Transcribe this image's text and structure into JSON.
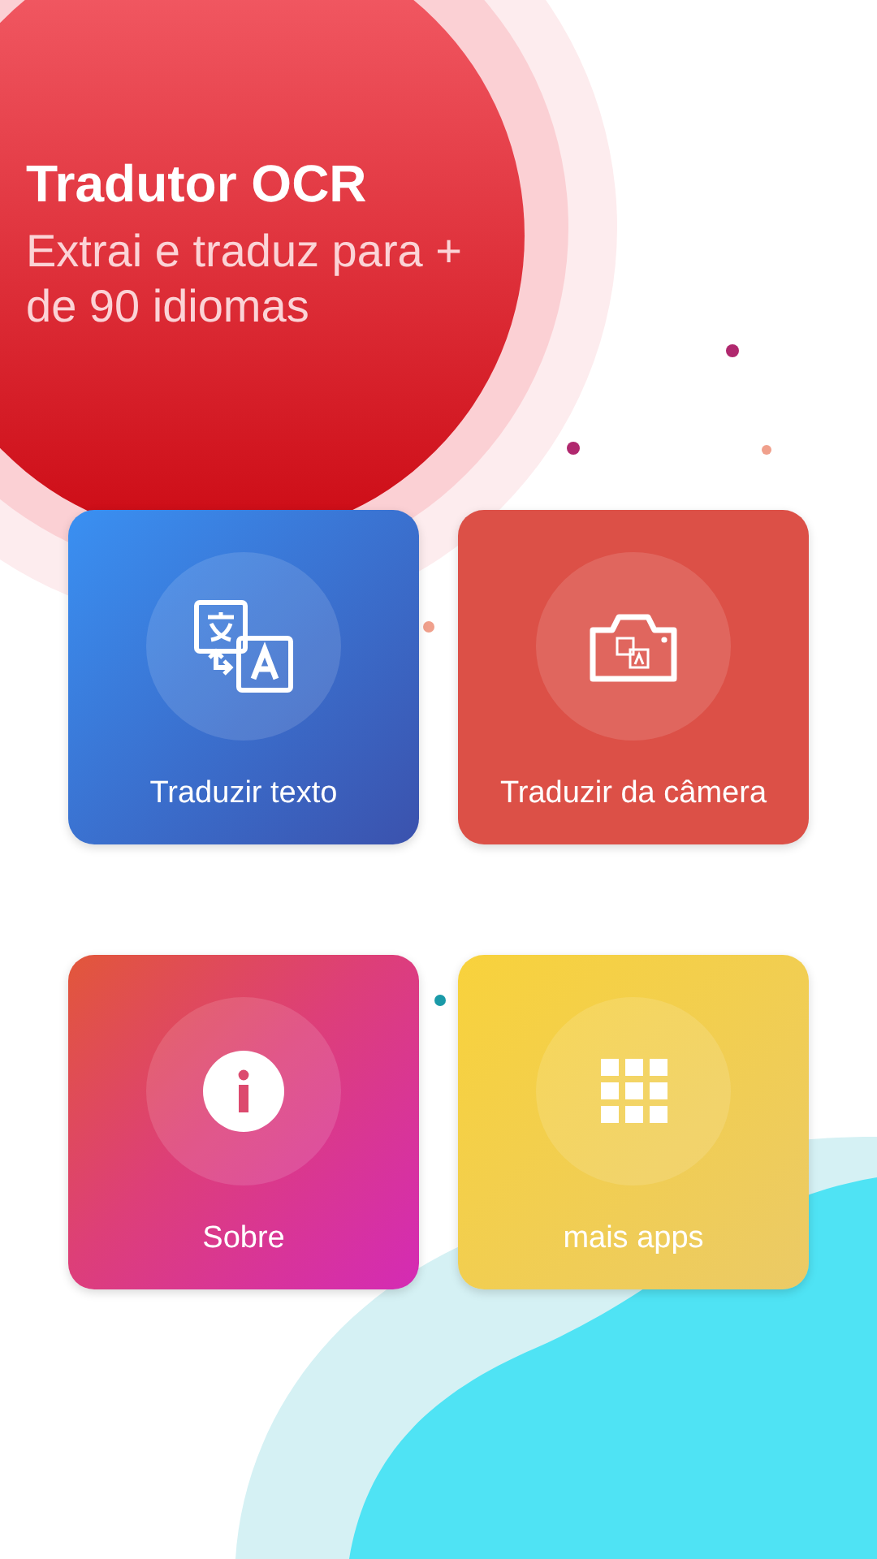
{
  "header": {
    "title": "Tradutor OCR",
    "subtitle": "Extrai e traduz para + de 90 idiomas"
  },
  "tiles": [
    {
      "kind": "translate",
      "label": "Traduzir texto"
    },
    {
      "kind": "camera",
      "label": "Traduzir da câmera"
    },
    {
      "kind": "info",
      "label": "Sobre"
    },
    {
      "kind": "apps",
      "label": "mais apps"
    }
  ]
}
